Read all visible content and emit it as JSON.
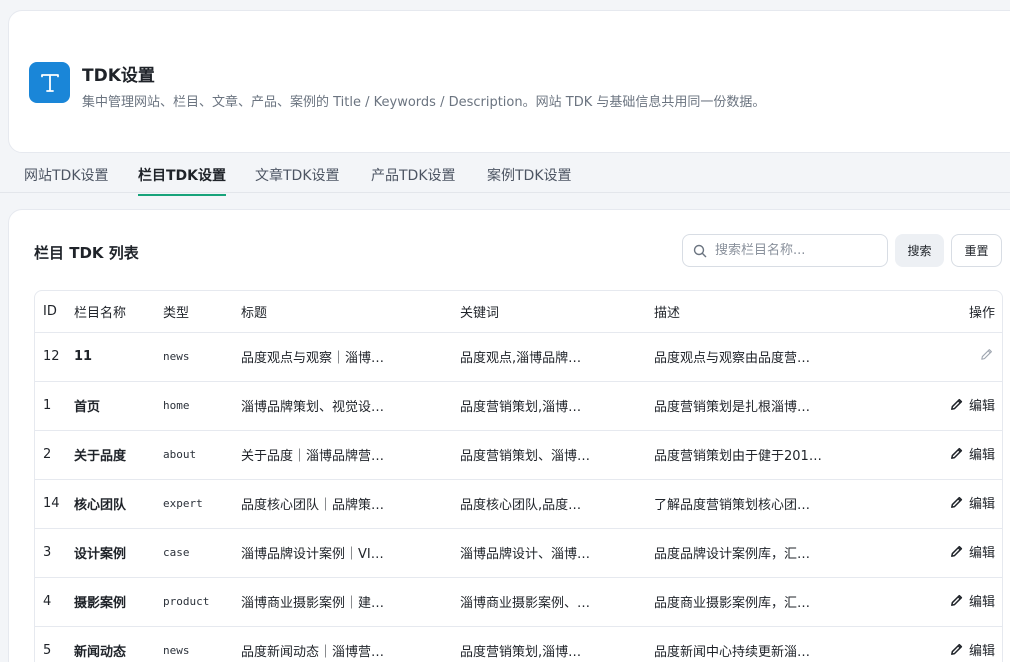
{
  "header": {
    "icon_glyph": "T",
    "title": "TDK设置",
    "description": "集中管理网站、栏目、文章、产品、案例的 Title / Keywords / Description。网站 TDK 与基础信息共用同一份数据。"
  },
  "tabs": [
    {
      "label": "网站TDK设置",
      "active": false
    },
    {
      "label": "栏目TDK设置",
      "active": true
    },
    {
      "label": "文章TDK设置",
      "active": false
    },
    {
      "label": "产品TDK设置",
      "active": false
    },
    {
      "label": "案例TDK设置",
      "active": false
    }
  ],
  "list": {
    "title": "栏目 TDK 列表",
    "search_placeholder": "搜索栏目名称...",
    "search_value": "",
    "search_button": "搜索",
    "reset_button": "重置"
  },
  "table": {
    "columns": [
      "ID",
      "栏目名称",
      "类型",
      "标题",
      "关键词",
      "描述",
      "操作"
    ],
    "edit_label": "编辑",
    "rows": [
      {
        "id": "12",
        "name": "11",
        "type": "news",
        "title": "品度观点与观察｜淄博…",
        "keywords": "品度观点,淄博品牌…",
        "description": "品度观点与观察由品度营…",
        "edit_label_shown": false
      },
      {
        "id": "1",
        "name": "首页",
        "type": "home",
        "title": "淄博品牌策划、视觉设…",
        "keywords": "品度营销策划,淄博…",
        "description": "品度营销策划是扎根淄博…",
        "edit_label_shown": true
      },
      {
        "id": "2",
        "name": "关于品度",
        "type": "about",
        "title": "关于品度｜淄博品牌营…",
        "keywords": "品度营销策划、淄博…",
        "description": "品度营销策划由于健于201…",
        "edit_label_shown": true
      },
      {
        "id": "14",
        "name": "核心团队",
        "type": "expert",
        "title": "品度核心团队｜品牌策…",
        "keywords": "品度核心团队,品度…",
        "description": "了解品度营销策划核心团…",
        "edit_label_shown": true
      },
      {
        "id": "3",
        "name": "设计案例",
        "type": "case",
        "title": "淄博品牌设计案例｜VI…",
        "keywords": "淄博品牌设计、淄博…",
        "description": "品度品牌设计案例库，汇…",
        "edit_label_shown": true
      },
      {
        "id": "4",
        "name": "摄影案例",
        "type": "product",
        "title": "淄博商业摄影案例｜建…",
        "keywords": "淄博商业摄影案例、…",
        "description": "品度商业摄影案例库，汇…",
        "edit_label_shown": true
      },
      {
        "id": "5",
        "name": "新闻动态",
        "type": "news",
        "title": "品度新闻动态｜淄博营…",
        "keywords": "品度营销策划,淄博…",
        "description": "品度新闻中心持续更新淄…",
        "edit_label_shown": true
      }
    ]
  },
  "colors": {
    "accent": "#1a86d8",
    "tab_underline": "#17a37a",
    "page_bg": "#f3f5f8"
  },
  "icons": [
    "text-t-icon",
    "search-icon",
    "pencil-icon"
  ]
}
